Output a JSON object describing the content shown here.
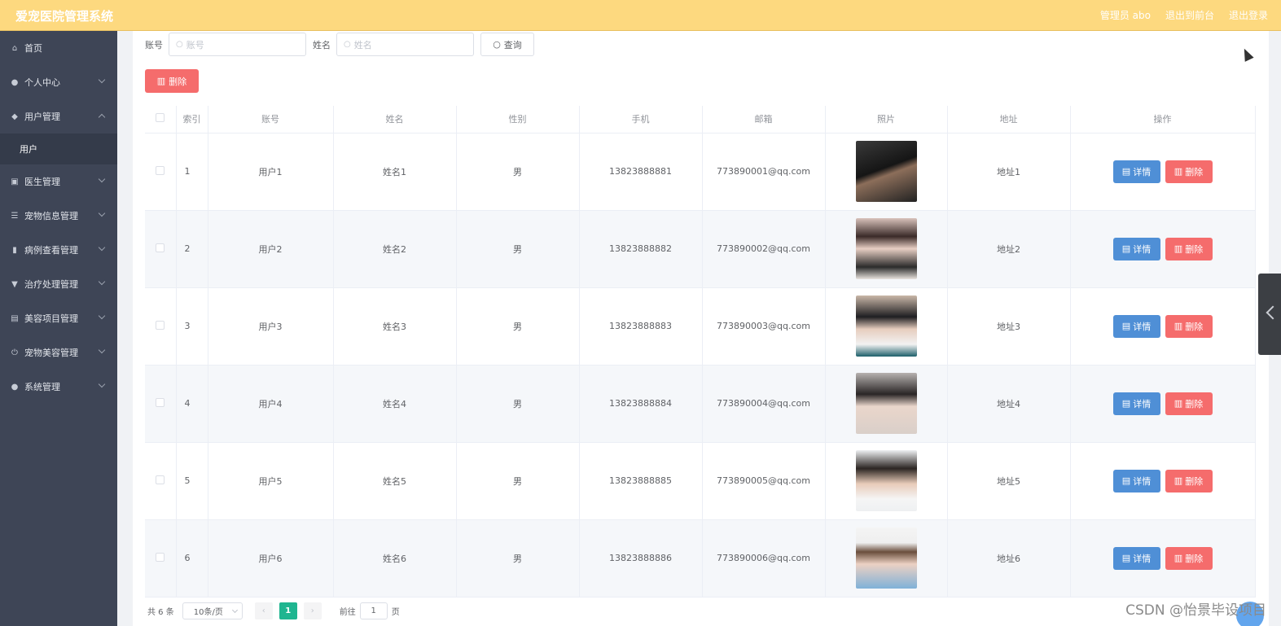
{
  "header": {
    "title": "爱宠医院管理系统",
    "admin_label": "管理员 abo",
    "back_to_front": "退出到前台",
    "logout": "退出登录",
    "bg_color": "#fdd97f"
  },
  "sidebar": {
    "items": [
      {
        "label": "首页",
        "icon": "home-icon"
      },
      {
        "label": "个人中心",
        "icon": "user-icon"
      },
      {
        "label": "用户管理",
        "icon": "pin-icon",
        "expanded": true
      },
      {
        "label": "用户",
        "sub": true
      },
      {
        "label": "医生管理",
        "icon": "card-icon"
      },
      {
        "label": "宠物信息管理",
        "icon": "list-icon"
      },
      {
        "label": "病例查看管理",
        "icon": "chart-icon"
      },
      {
        "label": "治疗处理管理",
        "icon": "cup-icon"
      },
      {
        "label": "美容项目管理",
        "icon": "clipboard-icon"
      },
      {
        "label": "宠物美容管理",
        "icon": "power-icon"
      },
      {
        "label": "系统管理",
        "icon": "mic-icon"
      }
    ]
  },
  "search": {
    "account_label": "账号",
    "account_placeholder": "账号",
    "name_label": "姓名",
    "name_placeholder": "姓名",
    "query_label": "查询"
  },
  "toolbar": {
    "delete_label": "删除"
  },
  "table": {
    "headers": [
      "索引",
      "账号",
      "姓名",
      "性别",
      "手机",
      "邮箱",
      "照片",
      "地址",
      "操作"
    ],
    "detail_label": "详情",
    "delete_label": "删除",
    "rows": [
      {
        "index": "1",
        "account": "用户1",
        "name": "姓名1",
        "gender": "男",
        "phone": "13823888881",
        "email": "773890001@qq.com",
        "address": "地址1",
        "photo": "portrait-1"
      },
      {
        "index": "2",
        "account": "用户2",
        "name": "姓名2",
        "gender": "男",
        "phone": "13823888882",
        "email": "773890002@qq.com",
        "address": "地址2",
        "photo": "portrait-2"
      },
      {
        "index": "3",
        "account": "用户3",
        "name": "姓名3",
        "gender": "男",
        "phone": "13823888883",
        "email": "773890003@qq.com",
        "address": "地址3",
        "photo": "portrait-3"
      },
      {
        "index": "4",
        "account": "用户4",
        "name": "姓名4",
        "gender": "男",
        "phone": "13823888884",
        "email": "773890004@qq.com",
        "address": "地址4",
        "photo": "portrait-4"
      },
      {
        "index": "5",
        "account": "用户5",
        "name": "姓名5",
        "gender": "男",
        "phone": "13823888885",
        "email": "773890005@qq.com",
        "address": "地址5",
        "photo": "portrait-5"
      },
      {
        "index": "6",
        "account": "用户6",
        "name": "姓名6",
        "gender": "男",
        "phone": "13823888886",
        "email": "773890006@qq.com",
        "address": "地址6",
        "photo": "portrait-6"
      }
    ]
  },
  "pagination": {
    "total_text": "共 6 条",
    "page_size": "10条/页",
    "current_page": "1",
    "goto_label": "前往",
    "goto_value": "1",
    "page_unit": "页"
  },
  "watermark": "CSDN @怡景毕设项目"
}
